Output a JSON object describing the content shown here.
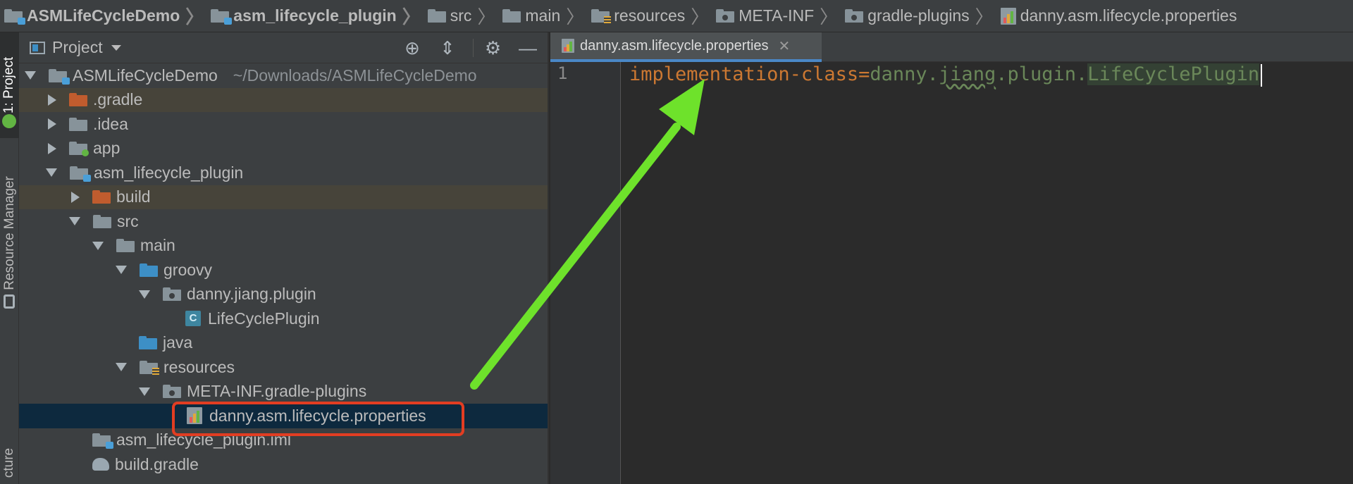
{
  "breadcrumb": [
    {
      "label": "ASMLifeCycleDemo",
      "icon": "module-folder-icon",
      "bold": true
    },
    {
      "label": "asm_lifecycle_plugin",
      "icon": "module-folder-icon",
      "bold": true
    },
    {
      "label": "src",
      "icon": "folder-icon",
      "bold": false
    },
    {
      "label": "main",
      "icon": "folder-icon",
      "bold": false
    },
    {
      "label": "resources",
      "icon": "resources-folder-icon",
      "bold": false
    },
    {
      "label": "META-INF",
      "icon": "package-folder-icon",
      "bold": false
    },
    {
      "label": "gradle-plugins",
      "icon": "package-folder-icon",
      "bold": false
    },
    {
      "label": "danny.asm.lifecycle.properties",
      "icon": "properties-file-icon",
      "bold": false
    }
  ],
  "toolstrip": {
    "project_tab": "1: Project",
    "resource_manager_tab": "Resource Manager",
    "structure_tab": "cture"
  },
  "project_panel": {
    "title": "Project",
    "tools": [
      "locate-icon",
      "collapse-all-icon",
      "gear-icon",
      "minimize-icon"
    ]
  },
  "tree": {
    "root": {
      "label": "ASMLifeCycleDemo",
      "path": "~/Downloads/ASMLifeCycleDemo"
    },
    "gradle": ".gradle",
    "idea": ".idea",
    "app": "app",
    "plugin_module": "asm_lifecycle_plugin",
    "build": "build",
    "src": "src",
    "main": "main",
    "groovy": "groovy",
    "package": "danny.jiang.plugin",
    "class_file": "LifeCyclePlugin",
    "java": "java",
    "resources": "resources",
    "meta_inf": "META-INF.gradle-plugins",
    "properties_file": "danny.asm.lifecycle.properties",
    "iml_file": "asm_lifecycle_plugin.iml",
    "build_gradle": "build.gradle"
  },
  "editor": {
    "tab_label": "danny.asm.lifecycle.properties",
    "line_number": "1",
    "code": {
      "key": "implementation-class",
      "equals": "=",
      "value_part1": "danny.",
      "value_part2": "jiang",
      "value_part3": ".plugin.",
      "value_part4": "LifeCyclePlugin"
    }
  },
  "colors": {
    "annotation_arrow": "#6ee22b",
    "highlight_box": "#e23d22",
    "keyword": "#cc7832",
    "string_value": "#6a8759",
    "selection": "#0d293e"
  }
}
